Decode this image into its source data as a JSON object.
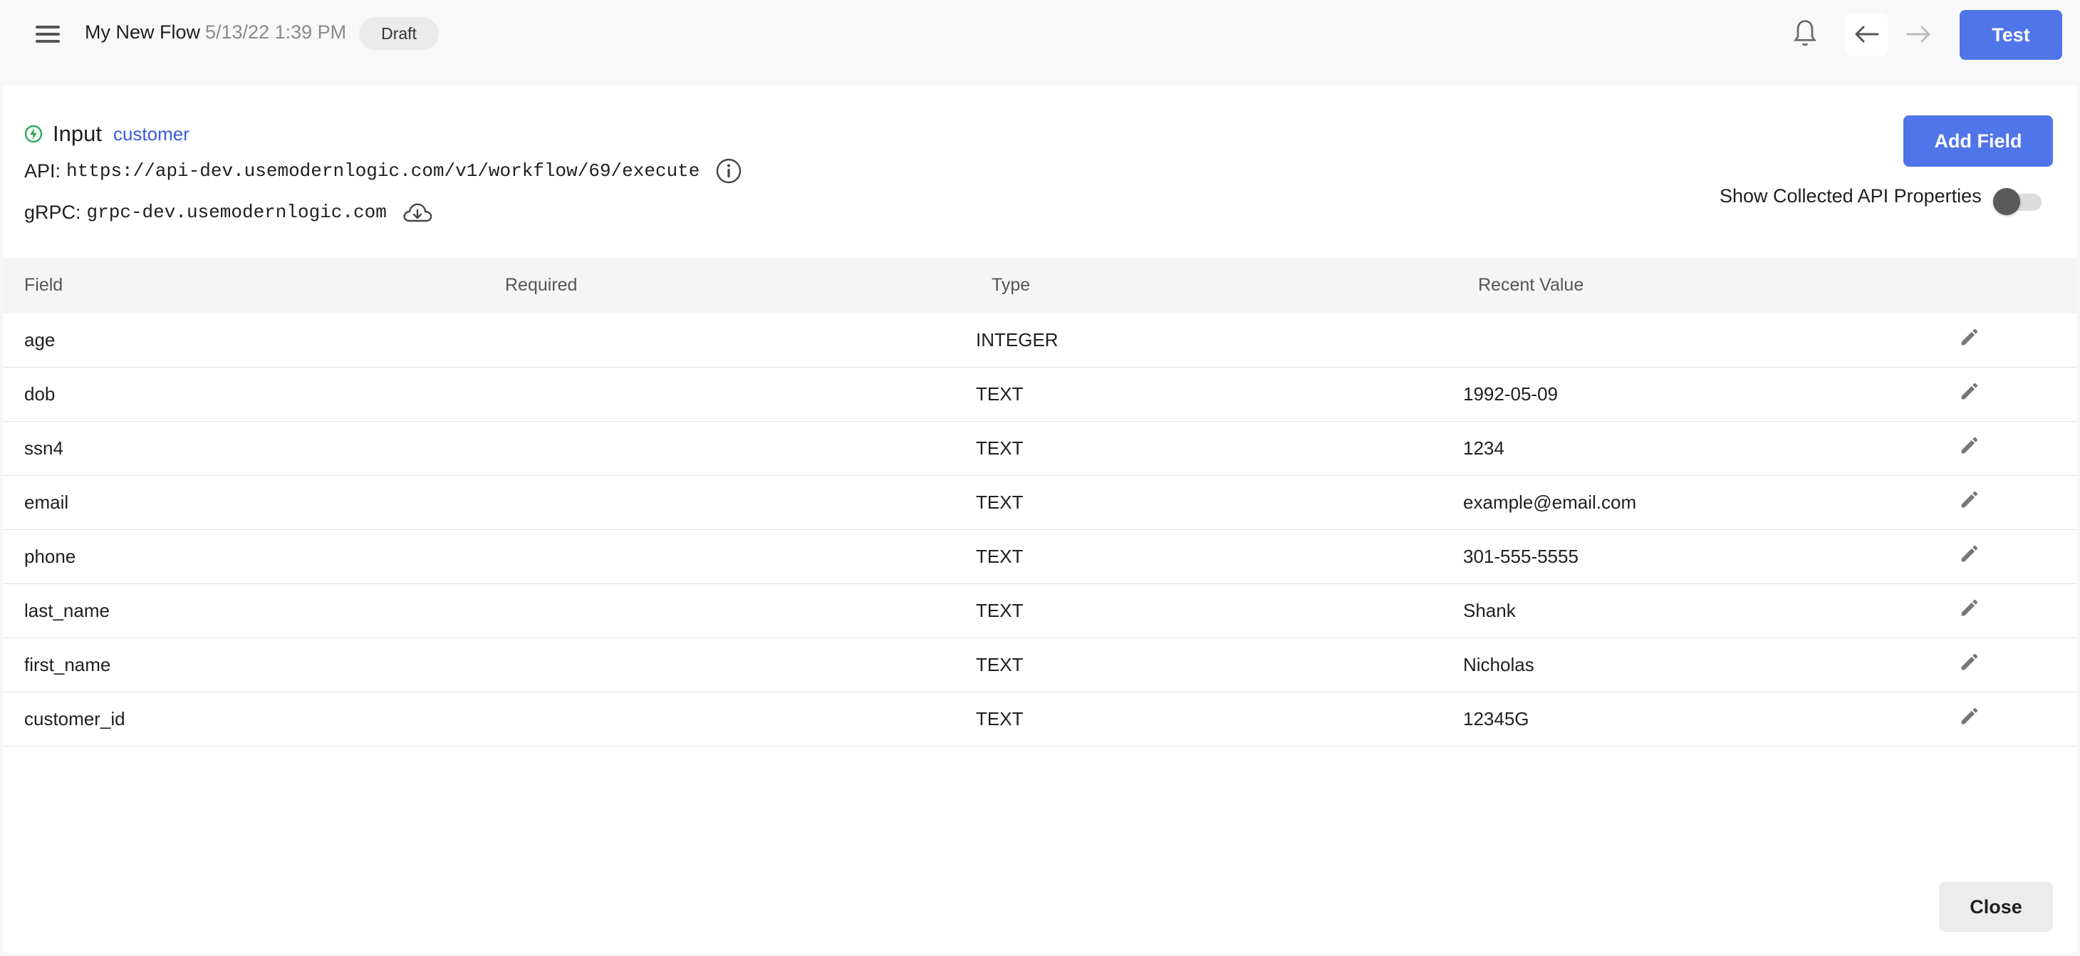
{
  "header": {
    "menu_icon": "hamburger-menu-icon",
    "title": "My New Flow",
    "date": "5/13/22 1:39 PM",
    "status_badge": "Draft",
    "bell_icon": "bell-icon",
    "back_icon": "arrow-left-icon",
    "forward_icon": "arrow-right-icon",
    "test_label": "Test",
    "accent_color": "#4f75e8"
  },
  "input": {
    "icon": "bolt-circle-icon",
    "title": "Input",
    "link": "customer",
    "api_label": "API:",
    "api_url": "https://api-dev.usemodernlogic.com/v1/workflow/69/execute",
    "grpc_label": "gRPC:",
    "grpc_url": "grpc-dev.usemodernlogic.com",
    "add_field_label": "Add Field",
    "toggle_label": "Show Collected API Properties",
    "toggle_on": false
  },
  "table": {
    "columns": [
      "Field",
      "Required",
      "Type",
      "Recent Value"
    ],
    "rows": [
      {
        "field": "age",
        "required": "",
        "type": "INTEGER",
        "recent": ""
      },
      {
        "field": "dob",
        "required": "",
        "type": "TEXT",
        "recent": "1992-05-09"
      },
      {
        "field": "ssn4",
        "required": "",
        "type": "TEXT",
        "recent": "1234"
      },
      {
        "field": "email",
        "required": "",
        "type": "TEXT",
        "recent": "example@email.com"
      },
      {
        "field": "phone",
        "required": "",
        "type": "TEXT",
        "recent": "301-555-5555"
      },
      {
        "field": "last_name",
        "required": "",
        "type": "TEXT",
        "recent": "Shank"
      },
      {
        "field": "first_name",
        "required": "",
        "type": "TEXT",
        "recent": "Nicholas"
      },
      {
        "field": "customer_id",
        "required": "",
        "type": "TEXT",
        "recent": "12345G"
      }
    ]
  },
  "footer": {
    "close_label": "Close"
  }
}
